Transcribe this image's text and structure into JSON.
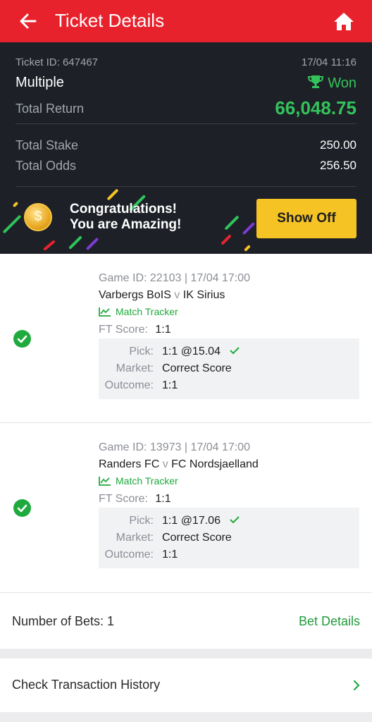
{
  "header": {
    "title": "Ticket Details",
    "icons": [
      "back-arrow-icon",
      "home-icon"
    ],
    "color": "#e8222d"
  },
  "summary": {
    "ticket_id_label": "Ticket ID: 647467",
    "date": "17/04 11:16",
    "bet_type": "Multiple",
    "status": "Won",
    "total_return_label": "Total Return",
    "total_return": "66,048.75",
    "total_stake_label": "Total Stake",
    "total_stake": "250.00",
    "total_odds_label": "Total Odds",
    "total_odds": "256.50"
  },
  "banner": {
    "line1": "Congratulations!",
    "line2": "You are Amazing!",
    "coin_symbol": "$",
    "button": "Show Off"
  },
  "legs": [
    {
      "game_id": "Game ID: 22103 | 17/04 17:00",
      "home": "Varbergs BoIS",
      "vs": "v",
      "away": "IK Sirius",
      "tracker": "Match Tracker",
      "ft_label": "FT Score:",
      "ft_score": "1:1",
      "pick_label": "Pick:",
      "pick": "1:1 @15.04",
      "market_label": "Market:",
      "market": "Correct Score",
      "outcome_label": "Outcome:",
      "outcome": "1:1"
    },
    {
      "game_id": "Game ID: 13973 | 17/04 17:00",
      "home": "Randers FC",
      "vs": "v",
      "away": "FC Nordsjaelland",
      "tracker": "Match Tracker",
      "ft_label": "FT Score:",
      "ft_score": "1:1",
      "pick_label": "Pick:",
      "pick": "1:1 @17.06",
      "market_label": "Market:",
      "market": "Correct Score",
      "outcome_label": "Outcome:",
      "outcome": "1:1"
    }
  ],
  "footer": {
    "number_of_bets": "Number of Bets: 1",
    "bet_details": "Bet Details",
    "check_history": "Check Transaction History"
  },
  "colors": {
    "accent_green": "#33c35a",
    "yellow": "#f6c325",
    "dark": "#1d2027"
  }
}
